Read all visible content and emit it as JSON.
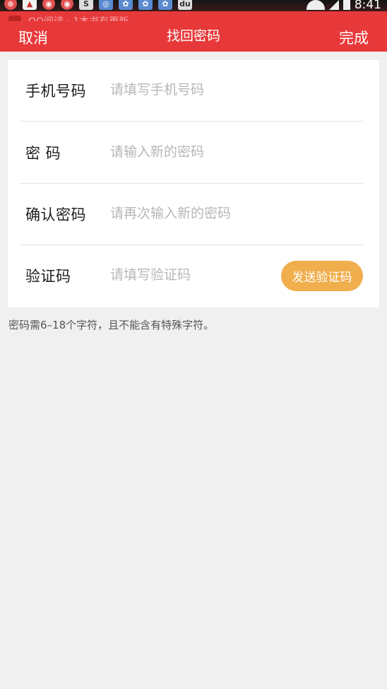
{
  "status_bar": {
    "time": "8:41",
    "icons": [
      "app-icon",
      "image-icon",
      "weibo-icon",
      "weibo-icon",
      "s-app-icon",
      "browser-icon",
      "baidu-icon",
      "baidu-icon",
      "baidu-icon",
      "du-app-icon"
    ]
  },
  "notification": {
    "text": "QQ阅读 · 1本书有更新"
  },
  "header": {
    "cancel_label": "取消",
    "title": "找回密码",
    "done_label": "完成"
  },
  "form": {
    "phone": {
      "label": "手机号码",
      "placeholder": "请填写手机号码",
      "value": ""
    },
    "password": {
      "label": "密 码",
      "placeholder": "请输入新的密码",
      "value": ""
    },
    "confirm": {
      "label": "确认密码",
      "placeholder": "请再次输入新的密码",
      "value": ""
    },
    "code": {
      "label": "验证码",
      "placeholder": "请填写验证码",
      "value": "",
      "send_label": "发送验证码"
    }
  },
  "hint": "密码需6–18个字符，且不能含有特殊字符。",
  "colors": {
    "header": "#e8393a",
    "send_button": "#f0ae4c",
    "background": "#f0f0f0"
  }
}
